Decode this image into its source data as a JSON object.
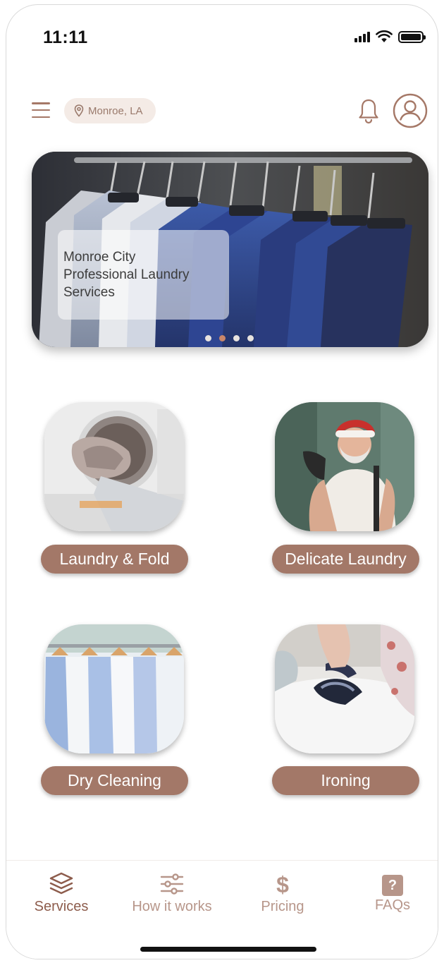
{
  "status_bar": {
    "time": "11:11"
  },
  "header": {
    "location": "Monroe, LA",
    "icons": {
      "menu": "hamburger-icon",
      "location": "map-pin-icon",
      "notifications": "bell-icon",
      "profile": "user-circle-icon"
    }
  },
  "hero": {
    "title_lines": [
      "Monroe City",
      "Professional Laundry",
      "Services"
    ],
    "carousel": {
      "total": 4,
      "active_index": 1
    }
  },
  "services": [
    {
      "label": "Laundry & Fold",
      "image": "washing-machine-photo"
    },
    {
      "label": "Delicate Laundry",
      "image": "man-with-iron-photo"
    },
    {
      "label": "Dry Cleaning",
      "image": "shirts-on-hangers-photo"
    },
    {
      "label": "Ironing",
      "image": "ironing-shirt-photo"
    }
  ],
  "bottom_nav": [
    {
      "label": "Services",
      "icon": "layers-icon",
      "active": true
    },
    {
      "label": "How it works",
      "icon": "sliders-icon",
      "active": false
    },
    {
      "label": "Pricing",
      "icon": "dollar-icon",
      "active": false
    },
    {
      "label": "FAQs",
      "icon": "question-icon",
      "active": false
    }
  ],
  "colors": {
    "accent": "#a37868",
    "accent_dark": "#8d5c4c",
    "chip_bg": "#f4ebe6",
    "nav_inactive": "#b7968a",
    "dot_active": "#c9876a"
  }
}
